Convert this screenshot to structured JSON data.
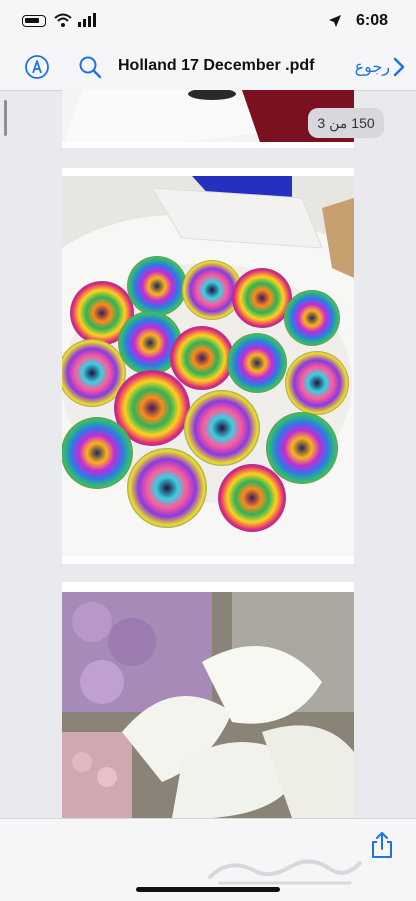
{
  "status": {
    "time": "6:08"
  },
  "toolbar": {
    "title": "Holland 17 December .pdf",
    "back_label": "رجوع"
  },
  "pages": {
    "current": "3",
    "separator": "من",
    "total": "150"
  },
  "colors": {
    "accent": "#1a73e8",
    "bar": "#f6f6f8",
    "background": "#e9eaee"
  }
}
